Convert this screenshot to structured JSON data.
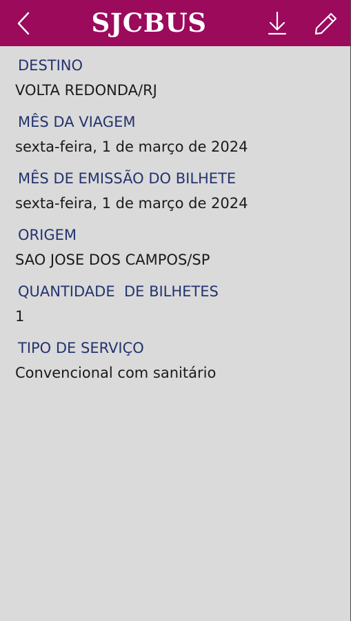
{
  "header": {
    "title": "SJCBUS",
    "background_color": "#9c0a5c",
    "icons": {
      "back": "chevron-left-icon",
      "download": "download-icon",
      "edit": "pencil-icon"
    }
  },
  "fields": [
    {
      "label": "DESTINO",
      "value": "VOLTA REDONDA/RJ"
    },
    {
      "label": "MÊS DA VIAGEM",
      "value": "sexta-feira, 1 de março de 2024"
    },
    {
      "label": "MÊS DE EMISSÃO DO BILHETE",
      "value": "sexta-feira, 1 de março de 2024"
    },
    {
      "label": "ORIGEM",
      "value": "SAO JOSE DOS CAMPOS/SP"
    },
    {
      "label": "QUANTIDADE  DE BILHETES",
      "value": "1"
    },
    {
      "label": "TIPO DE SERVIÇO",
      "value": "Convencional com sanitário"
    }
  ],
  "colors": {
    "label": "#23336e",
    "value": "#1a1a1a",
    "background": "#dadada"
  }
}
